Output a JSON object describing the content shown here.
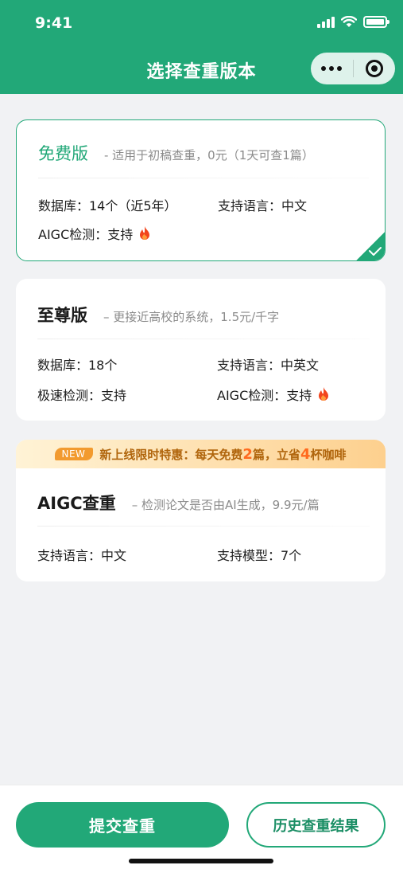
{
  "status": {
    "time": "9:41",
    "icons": [
      "signal-icon",
      "wifi-icon",
      "battery-icon"
    ]
  },
  "header": {
    "title": "选择查重版本",
    "capsule_icons": [
      "more-dots-icon",
      "close-target-icon"
    ]
  },
  "colors": {
    "brand": "#22a878",
    "promo_text": "#b0650c",
    "promo_accent": "#ff6a1e"
  },
  "versions": [
    {
      "name": "免费版",
      "desc": "- 适用于初稿查重，0元（1天可查1篇）",
      "selected": true,
      "attrs": [
        "数据库：14个（近5年）",
        "支持语言：中文",
        "AIGC检测：支持"
      ]
    },
    {
      "name": "至尊版",
      "desc": "– 更接近高校的系统，1.5元/千字",
      "selected": false,
      "attrs": [
        "数据库：18个",
        "支持语言：中英文",
        "极速检测：支持",
        "AIGC检测：支持"
      ]
    },
    {
      "name": "AIGC查重",
      "desc": "– 检测论文是否由AI生成，9.9元/篇",
      "selected": false,
      "attrs": [
        "支持语言：中文",
        "支持模型：7个"
      ],
      "promo": {
        "badge": "NEW",
        "text_a": "新上线限时特惠：每天免费",
        "num_a": "2",
        "text_b": "篇，立省",
        "num_b": "4",
        "text_c": "杯咖啡"
      }
    }
  ],
  "footer": {
    "submit_label": "提交查重",
    "history_label": "历史查重结果"
  }
}
